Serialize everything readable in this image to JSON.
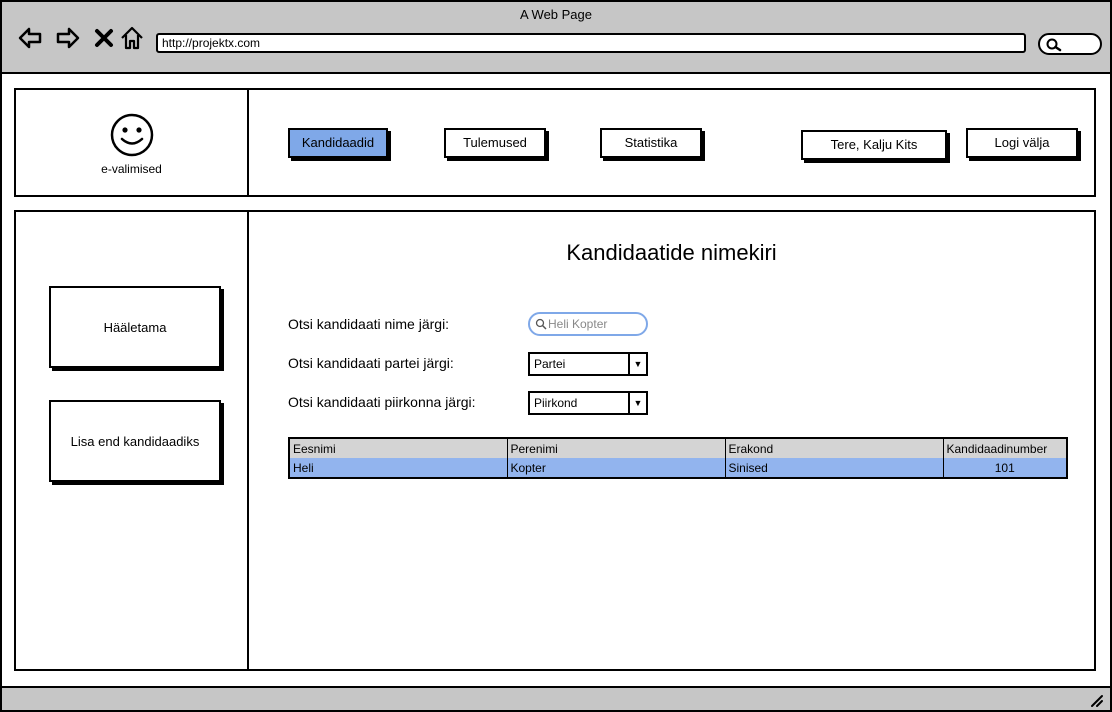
{
  "browser": {
    "title": "A Web Page",
    "url": "http://projektx.com"
  },
  "header": {
    "logo_label": "e-valimised",
    "nav": {
      "candidates": "Kandidaadid",
      "results": "Tulemused",
      "statistics": "Statistika"
    },
    "greeting": "Tere, Kalju Kits",
    "logout": "Logi välja"
  },
  "sidebar": {
    "vote": "Hääletama",
    "add_self": "Lisa end kandidaadiks"
  },
  "main": {
    "title": "Kandidaatide nimekiri",
    "search_name_label": "Otsi kandidaati nime järgi:",
    "search_name_placeholder": "Heli Kopter",
    "search_party_label": "Otsi kandidaati partei järgi:",
    "party_select": "Partei",
    "search_district_label": "Otsi kandidaati piirkonna järgi:",
    "district_select": "Piirkond",
    "table": {
      "columns": [
        "Eesnimi",
        "Perenimi",
        "Erakond",
        "Kandidaadinumber"
      ],
      "rows": [
        [
          "Heli",
          "Kopter",
          "Sinised",
          "101"
        ]
      ]
    }
  },
  "colors": {
    "active_button": "#7fa8e8",
    "row_highlight": "#92b4ee",
    "chrome": "#c6c6c6"
  }
}
